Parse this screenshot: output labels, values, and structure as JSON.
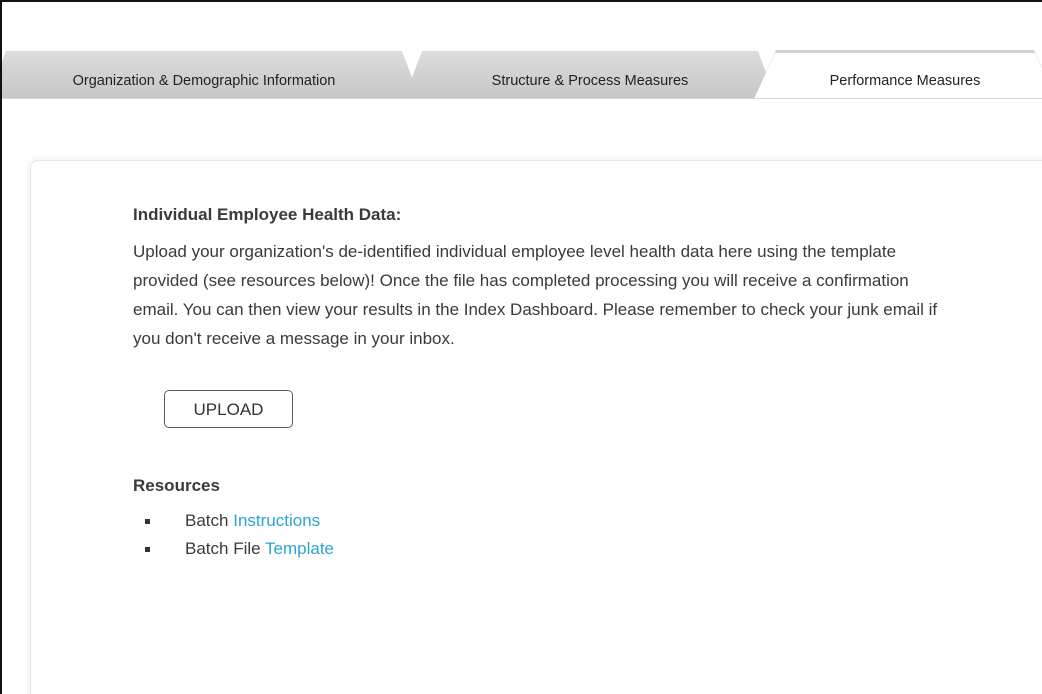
{
  "tabs": [
    {
      "label": "Organization & Demographic Information",
      "active": false
    },
    {
      "label": "Structure & Process Measures",
      "active": false
    },
    {
      "label": "Performance Measures",
      "active": true
    }
  ],
  "section": {
    "heading": "Individual Employee Health Data:",
    "description": "Upload your organization's de-identified individual employee level health data here using the template provided (see resources below)! Once the file has completed processing you will receive a confirmation email. You can then view your results in the Index Dashboard. Please remember to check your junk email if you don't receive a message in your inbox.",
    "upload_label": "UPLOAD"
  },
  "resources": {
    "title": "Resources",
    "items": [
      {
        "prefix": "Batch",
        "link": "Instructions"
      },
      {
        "prefix": "Batch File",
        "link": "Template"
      }
    ]
  },
  "colors": {
    "link": "#2aa6d1",
    "text": "#3a3a3a",
    "tab_inactive": "#cfcfcf"
  }
}
